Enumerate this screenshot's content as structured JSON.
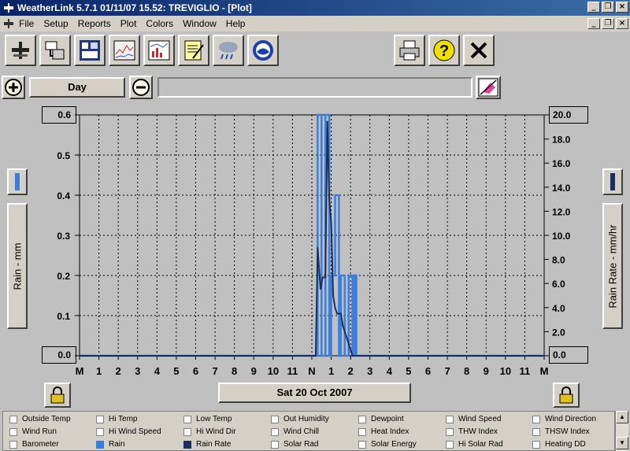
{
  "window": {
    "title": "WeatherLink 5.7.1  01/11/07  15.52: TREVIGLIO - [Plot]"
  },
  "menu": [
    "File",
    "Setup",
    "Reports",
    "Plot",
    "Colors",
    "Window",
    "Help"
  ],
  "toolbar": {
    "left_icons": [
      "station-icon",
      "download-icon",
      "bulletin-icon",
      "strip-chart-icon",
      "plot-icon",
      "notepad-icon",
      "weather-icon",
      "noaa-icon"
    ],
    "right_icons": [
      "print-icon",
      "help-icon",
      "close-icon"
    ]
  },
  "zoom": {
    "period_label": "Day"
  },
  "axes": {
    "left_label": "Rain - mm",
    "right_label": "Rain Rate - mm/hr",
    "left_ticks": [
      "0.6",
      "0.5",
      "0.4",
      "0.3",
      "0.2",
      "0.1",
      "0.0"
    ],
    "right_ticks": [
      "20.0",
      "18.0",
      "16.0",
      "14.0",
      "12.0",
      "10.0",
      "8.0",
      "6.0",
      "4.0",
      "2.0",
      "0.0"
    ],
    "x_ticks": [
      "M",
      "1",
      "2",
      "3",
      "4",
      "5",
      "6",
      "7",
      "8",
      "9",
      "10",
      "11",
      "N",
      "1",
      "2",
      "3",
      "4",
      "5",
      "6",
      "7",
      "8",
      "9",
      "10",
      "11",
      "M"
    ]
  },
  "date_label": "Sat 20 Oct 2007",
  "chart_data": {
    "type": "line",
    "xlabel": "",
    "ylabel": "Rain - mm",
    "y2label": "Rain Rate - mm/hr",
    "ylim": [
      0,
      0.6
    ],
    "y2lim": [
      0,
      20
    ],
    "x_range_hours": [
      0,
      24
    ],
    "grid": true,
    "series": [
      {
        "name": "Rain",
        "axis": "left",
        "color": "#3a7fe0",
        "x": [
          12.0,
          12.1,
          12.2,
          12.3,
          12.4,
          12.5,
          12.6,
          12.7,
          12.8,
          12.9,
          13.0,
          13.1,
          13.2,
          13.3,
          13.4,
          13.5,
          13.6,
          13.7,
          13.8,
          13.9,
          14.0,
          14.1,
          14.2,
          14.3,
          14.4,
          14.5,
          14.6,
          14.7,
          14.8,
          14.9,
          15.0
        ],
        "y": [
          0,
          0,
          0,
          0.6,
          0.6,
          0,
          0,
          0.6,
          0.6,
          0,
          0.2,
          0.2,
          0.4,
          0.4,
          0,
          0.2,
          0.2,
          0,
          0,
          0.2,
          0.2,
          0,
          0.2,
          0,
          0,
          0,
          0,
          0,
          0,
          0,
          0
        ]
      },
      {
        "name": "Rain Rate",
        "axis": "right",
        "color": "#1a3060",
        "x": [
          12.0,
          12.2,
          12.3,
          12.45,
          12.55,
          12.7,
          12.8,
          12.9,
          13.0,
          13.1,
          13.2,
          13.3,
          13.4,
          13.5,
          13.6,
          13.7,
          13.8,
          13.9,
          14.0,
          14.1,
          14.2
        ],
        "y": [
          0,
          0,
          9.0,
          5.5,
          6.5,
          6.5,
          19.5,
          13.0,
          11.0,
          5.0,
          4.0,
          3.5,
          3.5,
          3.5,
          2.5,
          2.0,
          1.5,
          1.0,
          0.5,
          0.0,
          0.0
        ]
      }
    ]
  },
  "legend": {
    "rows": [
      [
        "Outside Temp",
        "Hi Temp",
        "Low Temp",
        "Out Humidity",
        "Dewpoint",
        "Wind Speed",
        "Wind Direction"
      ],
      [
        "Wind Run",
        "Hi Wind Speed",
        "Hi Wind Dir",
        "Wind Chill",
        "Heat Index",
        "THW Index",
        "THSW Index"
      ],
      [
        "Barometer",
        "Rain",
        "Rain Rate",
        "Solar Rad",
        "Solar Energy",
        "Hi Solar Rad",
        "Heating DD"
      ]
    ],
    "checked": {
      "Rain": "#3a7fe0",
      "Rain Rate": "#1a3060"
    }
  },
  "colors": {
    "plot_bg": "#c0c0c0",
    "title_bar": "#0a246a",
    "noaa_blue": "#1a3fb0"
  }
}
